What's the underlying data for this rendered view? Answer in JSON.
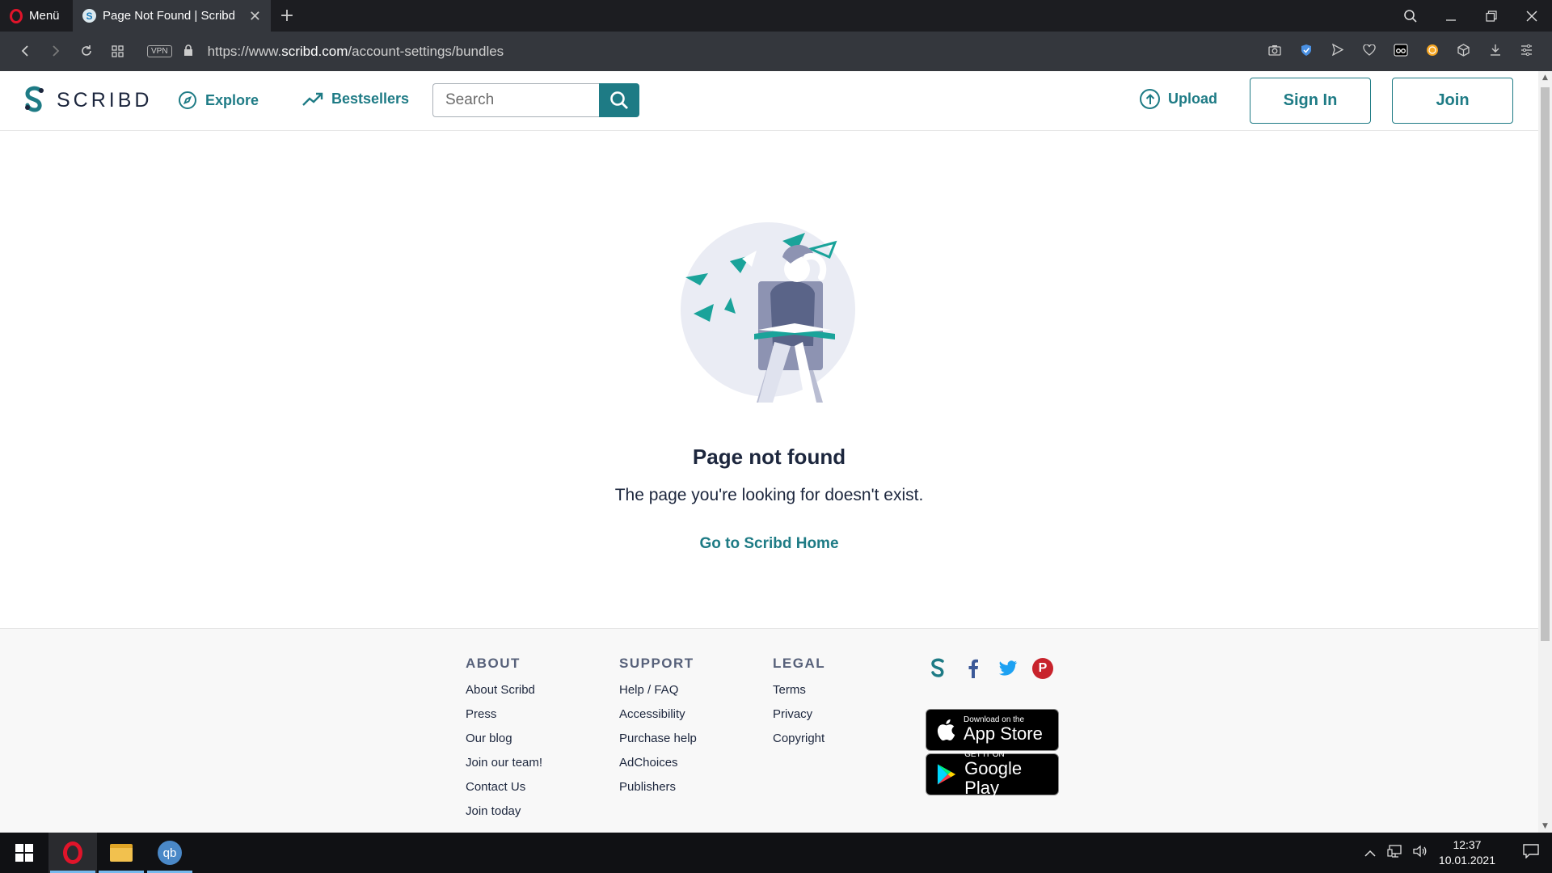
{
  "browser": {
    "menu_label": "Menü",
    "tab_title": "Page Not Found | Scribd",
    "tab_favicon": "S",
    "url_prefix": "https://www.",
    "url_domain": "scribd.com",
    "url_path": "/account-settings/bundles",
    "vpn_label": "VPN"
  },
  "header": {
    "logo_text": "SCRIBD",
    "nav": [
      {
        "label": "Explore",
        "icon": "compass-icon"
      },
      {
        "label": "Bestsellers",
        "icon": "trending-up-icon"
      }
    ],
    "search_placeholder": "Search",
    "upload_label": "Upload",
    "signin_label": "Sign In",
    "join_label": "Join"
  },
  "main": {
    "title": "Page not found",
    "description": "The page you're looking for doesn't exist.",
    "home_link": "Go to Scribd Home"
  },
  "footer": {
    "about": {
      "heading": "ABOUT",
      "links": [
        "About Scribd",
        "Press",
        "Our blog",
        "Join our team!",
        "Contact Us",
        "Join today"
      ]
    },
    "support": {
      "heading": "SUPPORT",
      "links": [
        "Help / FAQ",
        "Accessibility",
        "Purchase help",
        "AdChoices",
        "Publishers"
      ]
    },
    "legal": {
      "heading": "LEGAL",
      "links": [
        "Terms",
        "Privacy",
        "Copyright"
      ]
    },
    "appstore": {
      "small": "Download on the",
      "large": "App Store"
    },
    "googleplay": {
      "small": "GET IT ON",
      "large": "Google Play"
    }
  },
  "taskbar": {
    "time": "12:37",
    "date": "10.01.2021",
    "qb_label": "qb"
  },
  "colors": {
    "brand": "#1e7b85",
    "text_dark": "#1c263d"
  }
}
